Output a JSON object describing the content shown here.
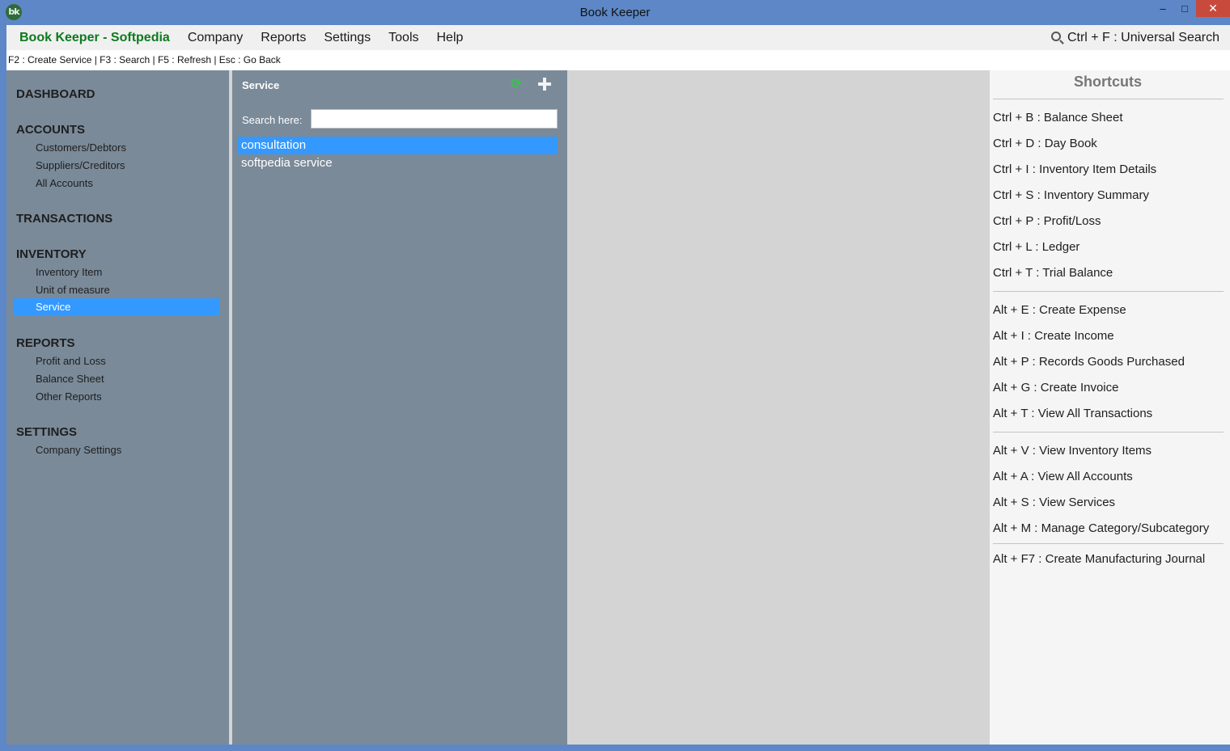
{
  "window": {
    "title": "Book Keeper",
    "logo_text": "bk",
    "minimize": "–",
    "maximize": "□",
    "close": "✕"
  },
  "menubar": {
    "brand": "Book Keeper - Softpedia",
    "items": [
      "Company",
      "Reports",
      "Settings",
      "Tools",
      "Help"
    ],
    "universal_search": "Ctrl + F  : Universal Search"
  },
  "hintbar": {
    "text": "F2 : Create Service | F3 : Search | F5 : Refresh | Esc : Go Back"
  },
  "nav": {
    "dashboard": "DASHBOARD",
    "accounts": "ACCOUNTS",
    "accounts_items": [
      "Customers/Debtors",
      "Suppliers/Creditors",
      "All Accounts"
    ],
    "transactions": "TRANSACTIONS",
    "inventory": "INVENTORY",
    "inventory_items": [
      "Inventory Item",
      "Unit of measure",
      "Service"
    ],
    "reports": "REPORTS",
    "reports_items": [
      "Profit and Loss",
      "Balance Sheet",
      "Other Reports"
    ],
    "settings": "SETTINGS",
    "settings_items": [
      "Company Settings"
    ],
    "selected_item": "Service"
  },
  "service_panel": {
    "title": "Service",
    "search_label": "Search here:",
    "search_value": "",
    "rows": [
      "consultation",
      "softpedia service"
    ],
    "selected_index": 0
  },
  "shortcuts": {
    "title": "Shortcuts",
    "items": [
      "Ctrl + B : Balance Sheet",
      "Ctrl + D : Day Book",
      "Ctrl + I  : Inventory Item Details",
      "Ctrl + S : Inventory Summary",
      "Ctrl + P : Profit/Loss",
      "Ctrl + L : Ledger",
      "Ctrl + T : Trial Balance",
      "Alt + E : Create Expense",
      "Alt + I  : Create Income",
      "Alt + P : Records Goods Purchased",
      "Alt + G : Create Invoice",
      "Alt + T : View All Transactions",
      "Alt + V : View Inventory Items",
      "Alt + A : View All Accounts",
      "Alt + S : View Services",
      "Alt + M : Manage Category/Subcategory",
      "Alt + F7 : Create Manufacturing Journal"
    ]
  },
  "colors": {
    "frame": "#5d87c6",
    "nav_bg": "#7a8a99",
    "selection": "#3399ff",
    "brand": "#0d7a1f"
  }
}
